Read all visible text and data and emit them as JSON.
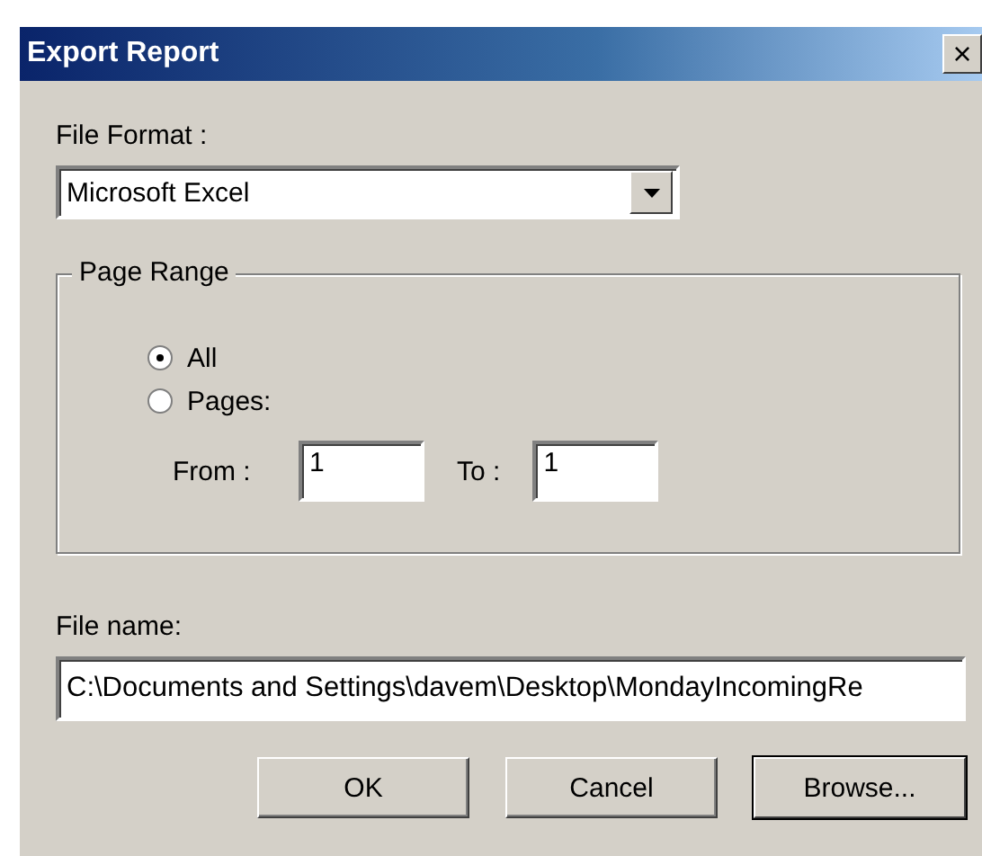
{
  "window": {
    "title": "Export Report",
    "close": "×"
  },
  "file_format": {
    "label": "File Format :",
    "value": "Microsoft Excel"
  },
  "page_range": {
    "title": "Page Range",
    "options": [
      {
        "label": "All",
        "selected": true
      },
      {
        "label": "Pages:",
        "selected": false
      }
    ],
    "from": {
      "label": "From :",
      "value": "1"
    },
    "to": {
      "label": "To :",
      "value": "1"
    }
  },
  "file_name": {
    "label": "File name:",
    "value": "C:\\Documents and Settings\\davem\\Desktop\\MondayIncomingRe"
  },
  "buttons": [
    {
      "label": "OK",
      "default": false
    },
    {
      "label": "Cancel",
      "default": false
    },
    {
      "label": "Browse...",
      "default": true
    }
  ]
}
